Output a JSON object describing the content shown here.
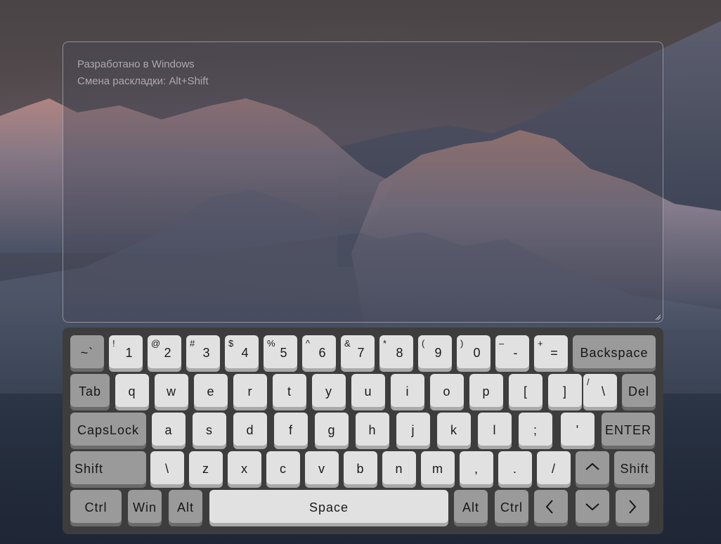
{
  "editor": {
    "line1": "Разработано в Windows",
    "line2": "Смена раскладки: Alt+Shift"
  },
  "keyboard": {
    "rows": [
      [
        {
          "name": "key-tilde",
          "type": "dark",
          "sup": "",
          "main": "~`"
        },
        {
          "name": "key-1",
          "sup": "!",
          "main": "1"
        },
        {
          "name": "key-2",
          "sup": "@",
          "main": "2"
        },
        {
          "name": "key-3",
          "sup": "#",
          "main": "3"
        },
        {
          "name": "key-4",
          "sup": "$",
          "main": "4"
        },
        {
          "name": "key-5",
          "sup": "%",
          "main": "5"
        },
        {
          "name": "key-6",
          "sup": "^",
          "main": "6"
        },
        {
          "name": "key-7",
          "sup": "&",
          "main": "7"
        },
        {
          "name": "key-8",
          "sup": "*",
          "main": "8"
        },
        {
          "name": "key-9",
          "sup": "(",
          "main": "9"
        },
        {
          "name": "key-0",
          "sup": ")",
          "main": "0"
        },
        {
          "name": "key-minus",
          "sup": "–",
          "main": "-"
        },
        {
          "name": "key-equals",
          "sup": "+",
          "main": "="
        },
        {
          "name": "key-backspace",
          "type": "dark",
          "sup": "",
          "main": "Backspace"
        }
      ],
      [
        {
          "name": "key-tab",
          "type": "dark",
          "sup": "",
          "main": "Tab"
        },
        {
          "name": "key-q",
          "sup": "",
          "main": "q"
        },
        {
          "name": "key-w",
          "sup": "",
          "main": "w"
        },
        {
          "name": "key-e",
          "sup": "",
          "main": "e"
        },
        {
          "name": "key-r",
          "sup": "",
          "main": "r"
        },
        {
          "name": "key-t",
          "sup": "",
          "main": "t"
        },
        {
          "name": "key-y",
          "sup": "",
          "main": "y"
        },
        {
          "name": "key-u",
          "sup": "",
          "main": "u"
        },
        {
          "name": "key-i",
          "sup": "",
          "main": "i"
        },
        {
          "name": "key-o",
          "sup": "",
          "main": "o"
        },
        {
          "name": "key-p",
          "sup": "",
          "main": "p"
        },
        {
          "name": "key-bracket-left",
          "sup": "",
          "main": "["
        },
        {
          "name": "key-bracket-right",
          "sup": "",
          "main": "]"
        },
        {
          "name": "key-backslash",
          "sup": "/",
          "main": "\\"
        },
        {
          "name": "key-del",
          "type": "dark",
          "sup": "",
          "main": "Del"
        }
      ],
      [
        {
          "name": "key-capslock",
          "type": "dark",
          "sup": "",
          "main": "CapsLock"
        },
        {
          "name": "key-a",
          "sup": "",
          "main": "a"
        },
        {
          "name": "key-s",
          "sup": "",
          "main": "s"
        },
        {
          "name": "key-d",
          "sup": "",
          "main": "d"
        },
        {
          "name": "key-f",
          "sup": "",
          "main": "f"
        },
        {
          "name": "key-g",
          "sup": "",
          "main": "g"
        },
        {
          "name": "key-h",
          "sup": "",
          "main": "h"
        },
        {
          "name": "key-j",
          "sup": "",
          "main": "j"
        },
        {
          "name": "key-k",
          "sup": "",
          "main": "k"
        },
        {
          "name": "key-l",
          "sup": "",
          "main": "l"
        },
        {
          "name": "key-semicolon",
          "sup": "",
          "main": ";"
        },
        {
          "name": "key-quote",
          "sup": "",
          "main": "'"
        },
        {
          "name": "key-enter",
          "type": "dark",
          "sup": "",
          "main": "ENTER"
        }
      ],
      [
        {
          "name": "key-shift-left",
          "type": "dark",
          "sup": "",
          "main": "Shift"
        },
        {
          "name": "key-backslash-2",
          "sup": "",
          "main": "\\"
        },
        {
          "name": "key-z",
          "sup": "",
          "main": "z"
        },
        {
          "name": "key-x",
          "sup": "",
          "main": "x"
        },
        {
          "name": "key-c",
          "sup": "",
          "main": "c"
        },
        {
          "name": "key-v",
          "sup": "",
          "main": "v"
        },
        {
          "name": "key-b",
          "sup": "",
          "main": "b"
        },
        {
          "name": "key-n",
          "sup": "",
          "main": "n"
        },
        {
          "name": "key-m",
          "sup": "",
          "main": "m"
        },
        {
          "name": "key-comma",
          "sup": "",
          "main": ","
        },
        {
          "name": "key-period",
          "sup": "",
          "main": "."
        },
        {
          "name": "key-slash",
          "sup": "",
          "main": "/"
        },
        {
          "name": "key-arrow-up",
          "type": "dark",
          "icon": "arrow-up-icon"
        },
        {
          "name": "key-shift-right",
          "type": "dark",
          "sup": "",
          "main": "Shift"
        }
      ],
      [
        {
          "name": "key-ctrl-left",
          "type": "dark",
          "sup": "",
          "main": "Ctrl"
        },
        {
          "name": "key-win",
          "type": "dark",
          "sup": "",
          "main": "Win"
        },
        {
          "name": "key-alt-left",
          "type": "dark",
          "sup": "",
          "main": "Alt"
        },
        {
          "name": "key-space",
          "sup": "",
          "main": "Space"
        },
        {
          "name": "key-alt-right",
          "type": "dark",
          "sup": "",
          "main": "Alt"
        },
        {
          "name": "key-ctrl-right",
          "type": "dark",
          "sup": "",
          "main": "Ctrl"
        },
        {
          "name": "key-arrow-left",
          "type": "dark",
          "icon": "arrow-left-icon"
        },
        {
          "name": "key-arrow-down",
          "type": "dark",
          "icon": "arrow-down-icon"
        },
        {
          "name": "key-arrow-right",
          "type": "dark",
          "icon": "arrow-right-icon"
        }
      ]
    ]
  }
}
